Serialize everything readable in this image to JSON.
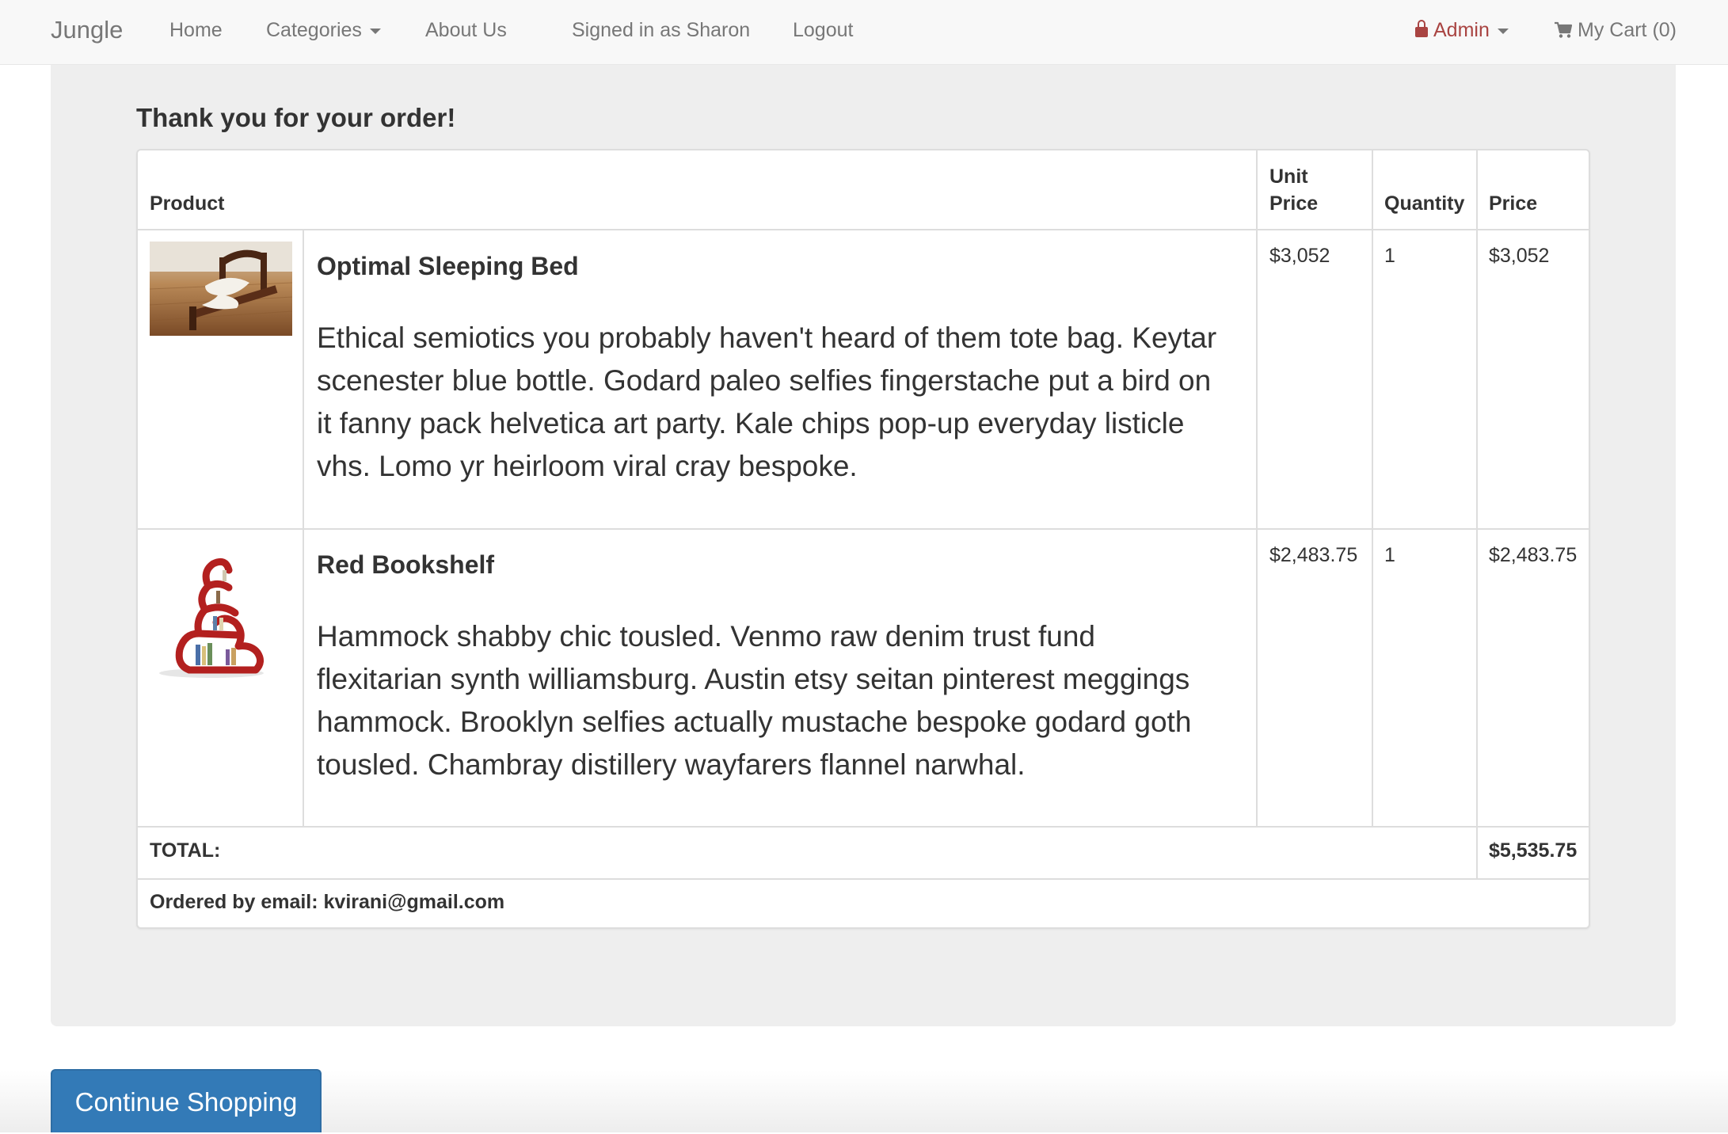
{
  "navbar": {
    "brand": "Jungle",
    "home": "Home",
    "categories": "Categories",
    "about": "About Us",
    "signed_in": "Signed in as Sharon",
    "logout": "Logout",
    "admin": "Admin",
    "cart": "My Cart (0)",
    "admin_color": "#a94442"
  },
  "order": {
    "title": "Thank you for your order!",
    "headers": {
      "product": "Product",
      "unit_price_line1": "Unit",
      "unit_price_line2": "Price",
      "quantity": "Quantity",
      "price": "Price"
    },
    "items": [
      {
        "name": "Optimal Sleeping Bed",
        "description": "Ethical semiotics you probably haven't heard of them tote bag. Keytar scenester blue bottle. Godard paleo selfies fingerstache put a bird on it fanny pack helvetica art party. Kale chips pop-up everyday listicle vhs. Lomo yr heirloom viral cray bespoke.",
        "unit_price": "$3,052",
        "quantity": "1",
        "price": "$3,052",
        "image": "bed-image"
      },
      {
        "name": "Red Bookshelf",
        "description": "Hammock shabby chic tousled. Venmo raw denim trust fund flexitarian synth williamsburg. Austin etsy seitan pinterest meggings hammock. Brooklyn selfies actually mustache bespoke godard goth tousled. Chambray distillery wayfarers flannel narwhal.",
        "unit_price": "$2,483.75",
        "quantity": "1",
        "price": "$2,483.75",
        "image": "bookshelf-image"
      }
    ],
    "total_label": "TOTAL:",
    "total_value": "$5,535.75",
    "ordered_by": "Ordered by email: kvirani@gmail.com"
  },
  "actions": {
    "continue_shopping": "Continue Shopping",
    "primary_color": "#337ab7"
  }
}
